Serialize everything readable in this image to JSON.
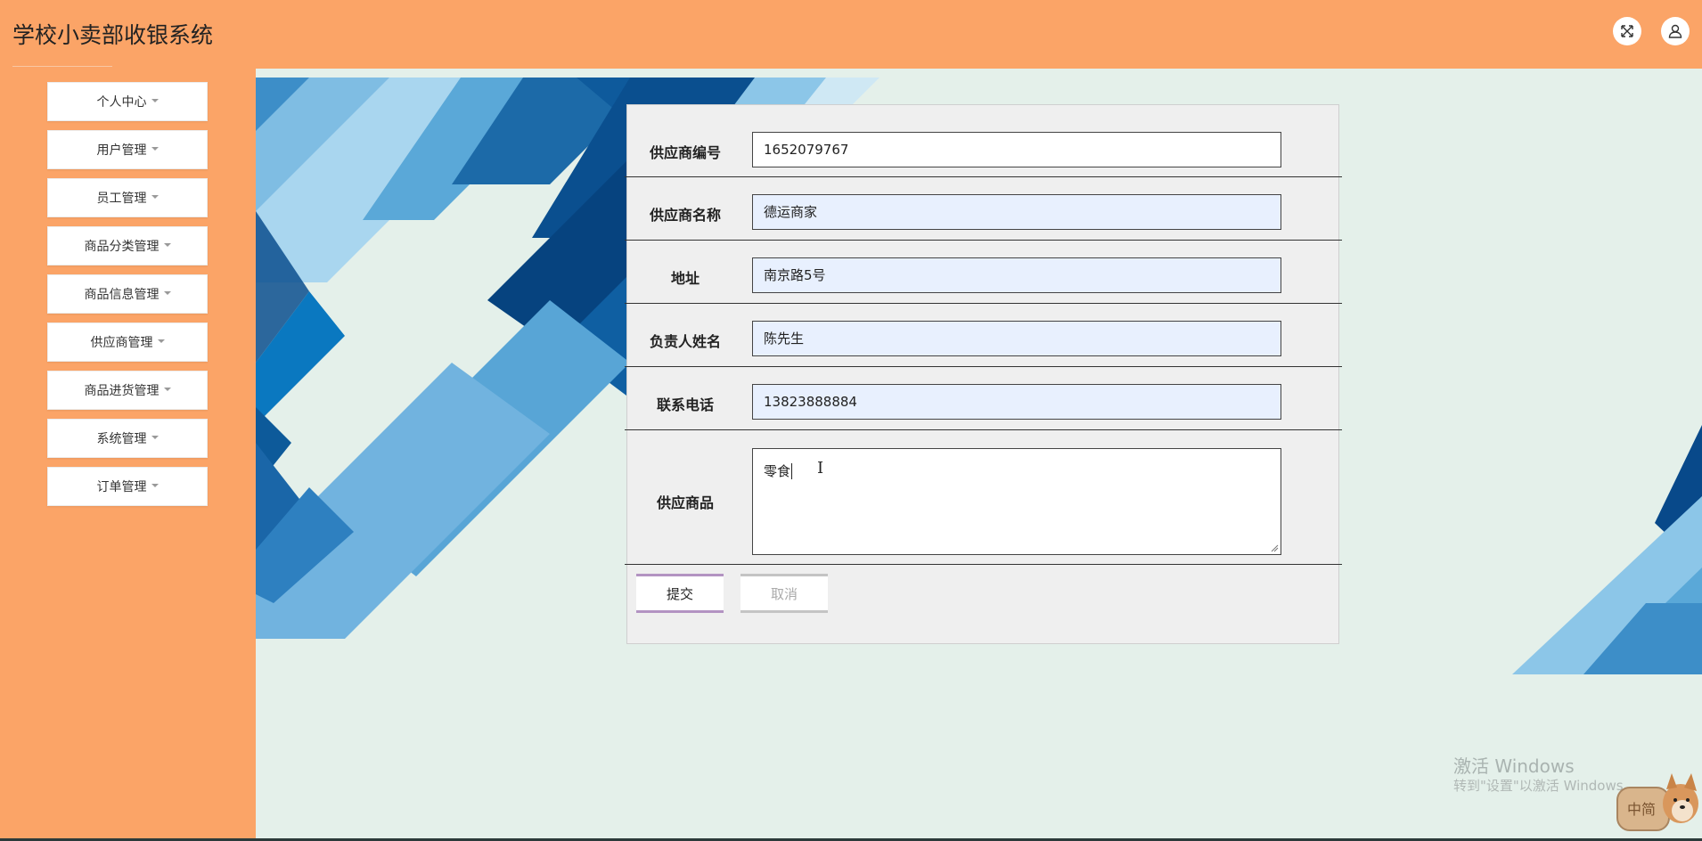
{
  "header": {
    "title": "学校小卖部收银系统",
    "fullscreen_icon": "expand-icon",
    "user_icon": "user-icon"
  },
  "sidebar": {
    "items": [
      {
        "label": "个人中心"
      },
      {
        "label": "用户管理"
      },
      {
        "label": "员工管理"
      },
      {
        "label": "商品分类管理"
      },
      {
        "label": "商品信息管理"
      },
      {
        "label": "供应商管理"
      },
      {
        "label": "商品进货管理"
      },
      {
        "label": "系统管理"
      },
      {
        "label": "订单管理"
      }
    ]
  },
  "form": {
    "supplier_id": {
      "label": "供应商编号",
      "value": "1652079767"
    },
    "supplier_name": {
      "label": "供应商名称",
      "value": "德运商家"
    },
    "address": {
      "label": "地址",
      "value": "南京路5号"
    },
    "contact_name": {
      "label": "负责人姓名",
      "value": "陈先生"
    },
    "phone": {
      "label": "联系电话",
      "value": "13823888884"
    },
    "products": {
      "label": "供应商品",
      "value": "零食"
    },
    "submit_label": "提交",
    "cancel_label": "取消"
  },
  "watermark": {
    "title": "激活 Windows",
    "subtitle": "转到\"设置\"以激活 Windows。",
    "badge_text": "中简"
  },
  "colors": {
    "header_bg": "#fba467",
    "main_bg": "#e4f0ea",
    "submit_accent": "#b393c2"
  }
}
